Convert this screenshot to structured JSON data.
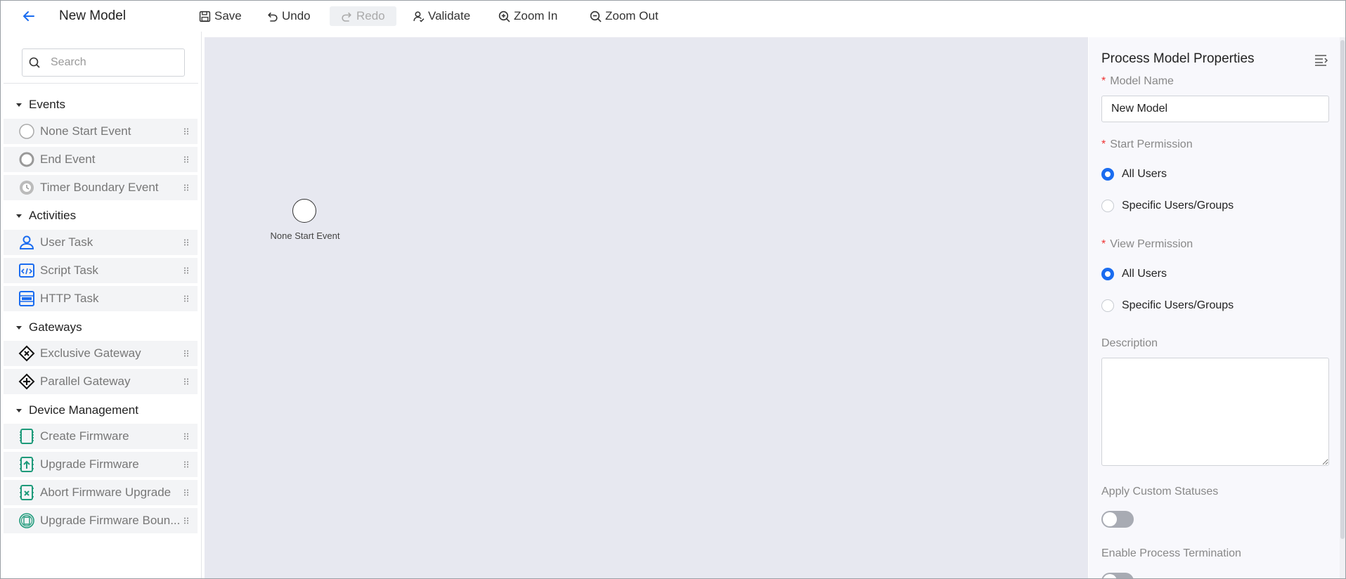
{
  "toolbar": {
    "title": "New Model",
    "save": "Save",
    "undo": "Undo",
    "redo": "Redo",
    "validate": "Validate",
    "zoom_in": "Zoom In",
    "zoom_out": "Zoom Out"
  },
  "palette": {
    "search_placeholder": "Search",
    "groups": [
      {
        "label": "Events",
        "items": [
          {
            "label": "None Start Event",
            "icon": "start-event-icon"
          },
          {
            "label": "End Event",
            "icon": "end-event-icon"
          },
          {
            "label": "Timer Boundary Event",
            "icon": "timer-icon"
          }
        ]
      },
      {
        "label": "Activities",
        "items": [
          {
            "label": "User Task",
            "icon": "user-icon"
          },
          {
            "label": "Script Task",
            "icon": "script-icon"
          },
          {
            "label": "HTTP Task",
            "icon": "http-icon"
          }
        ]
      },
      {
        "label": "Gateways",
        "items": [
          {
            "label": "Exclusive Gateway",
            "icon": "exclusive-gateway-icon"
          },
          {
            "label": "Parallel Gateway",
            "icon": "parallel-gateway-icon"
          }
        ]
      },
      {
        "label": "Device Management",
        "items": [
          {
            "label": "Create Firmware",
            "icon": "create-firmware-icon"
          },
          {
            "label": "Upgrade Firmware",
            "icon": "upgrade-firmware-icon"
          },
          {
            "label": "Abort Firmware Upgrade",
            "icon": "abort-firmware-icon"
          },
          {
            "label": "Upgrade Firmware Boun...",
            "icon": "firmware-boundary-icon"
          }
        ]
      }
    ]
  },
  "canvas": {
    "node_label": "None Start Event"
  },
  "properties": {
    "title": "Process Model Properties",
    "model_name_label": "Model Name",
    "model_name_value": "New Model",
    "start_permission_label": "Start Permission",
    "view_permission_label": "View Permission",
    "option_all": "All Users",
    "option_specific": "Specific Users/Groups",
    "description_label": "Description",
    "custom_statuses_label": "Apply Custom Statuses",
    "termination_label": "Enable Process Termination"
  },
  "colors": {
    "accent": "#1a6cf0",
    "teal": "#1e9a7a",
    "required": "#e33333"
  }
}
